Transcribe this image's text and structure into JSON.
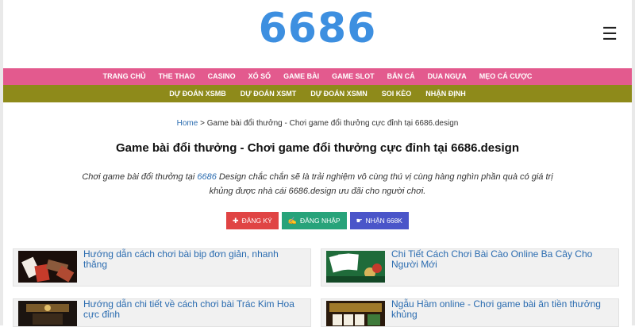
{
  "header": {
    "logo_text": "6686",
    "menu_icon": "hamburger-icon"
  },
  "nav_primary": [
    "TRANG CHỦ",
    "THE THAO",
    "CASINO",
    "XỔ SỐ",
    "GAME BÀI",
    "GAME SLOT",
    "BẮN CÁ",
    "DUA NGỰA",
    "MẸO CÁ CƯỢC"
  ],
  "nav_secondary": [
    "DỰ ĐOÁN XSMB",
    "DỰ ĐOÁN XSMT",
    "DỰ ĐOÁN XSMN",
    "SOI KÈO",
    "NHẬN ĐỊNH"
  ],
  "breadcrumb": {
    "home": "Home",
    "separator": " > ",
    "current": "Game bài đổi thưởng - Chơi game đổi thưởng cực đỉnh tại 6686.design"
  },
  "page_title": "Game bài đổi thưởng - Chơi game đổi thưởng cực đỉnh tại 6686.design",
  "intro": {
    "part1": "Chơi game bài đổi thưởng tại ",
    "brand": "6686",
    "part2": " Design chắc chắn sẽ là trải nghiệm vô cùng thú vị cùng hàng nghìn phần quà có giá trị khủng được nhà cái 6686.design ưu đãi cho người chơi."
  },
  "buttons": {
    "register": "ĐĂNG KÝ",
    "login": "ĐĂNG NHẬP",
    "receive": "NHẬN 668K"
  },
  "articles": [
    {
      "title": "Hướng dẫn cách chơi bài bịp đơn giản, nhanh thắng"
    },
    {
      "title": "Chi Tiết Cách Chơi Bài Cào Online Ba Cây Cho Người Mới"
    },
    {
      "title": "Hướng dẫn chi tiết về cách chơi bài Trác Kim Hoa cực đỉnh"
    },
    {
      "title": "Ngẫu Hầm online - Chơi game bài ăn tiền thưởng khủng"
    }
  ],
  "colors": {
    "nav_primary_bg": "#e35a8e",
    "nav_secondary_bg": "#8e8a1a",
    "logo": "#3d8fe0",
    "link": "#2b6cb0"
  }
}
